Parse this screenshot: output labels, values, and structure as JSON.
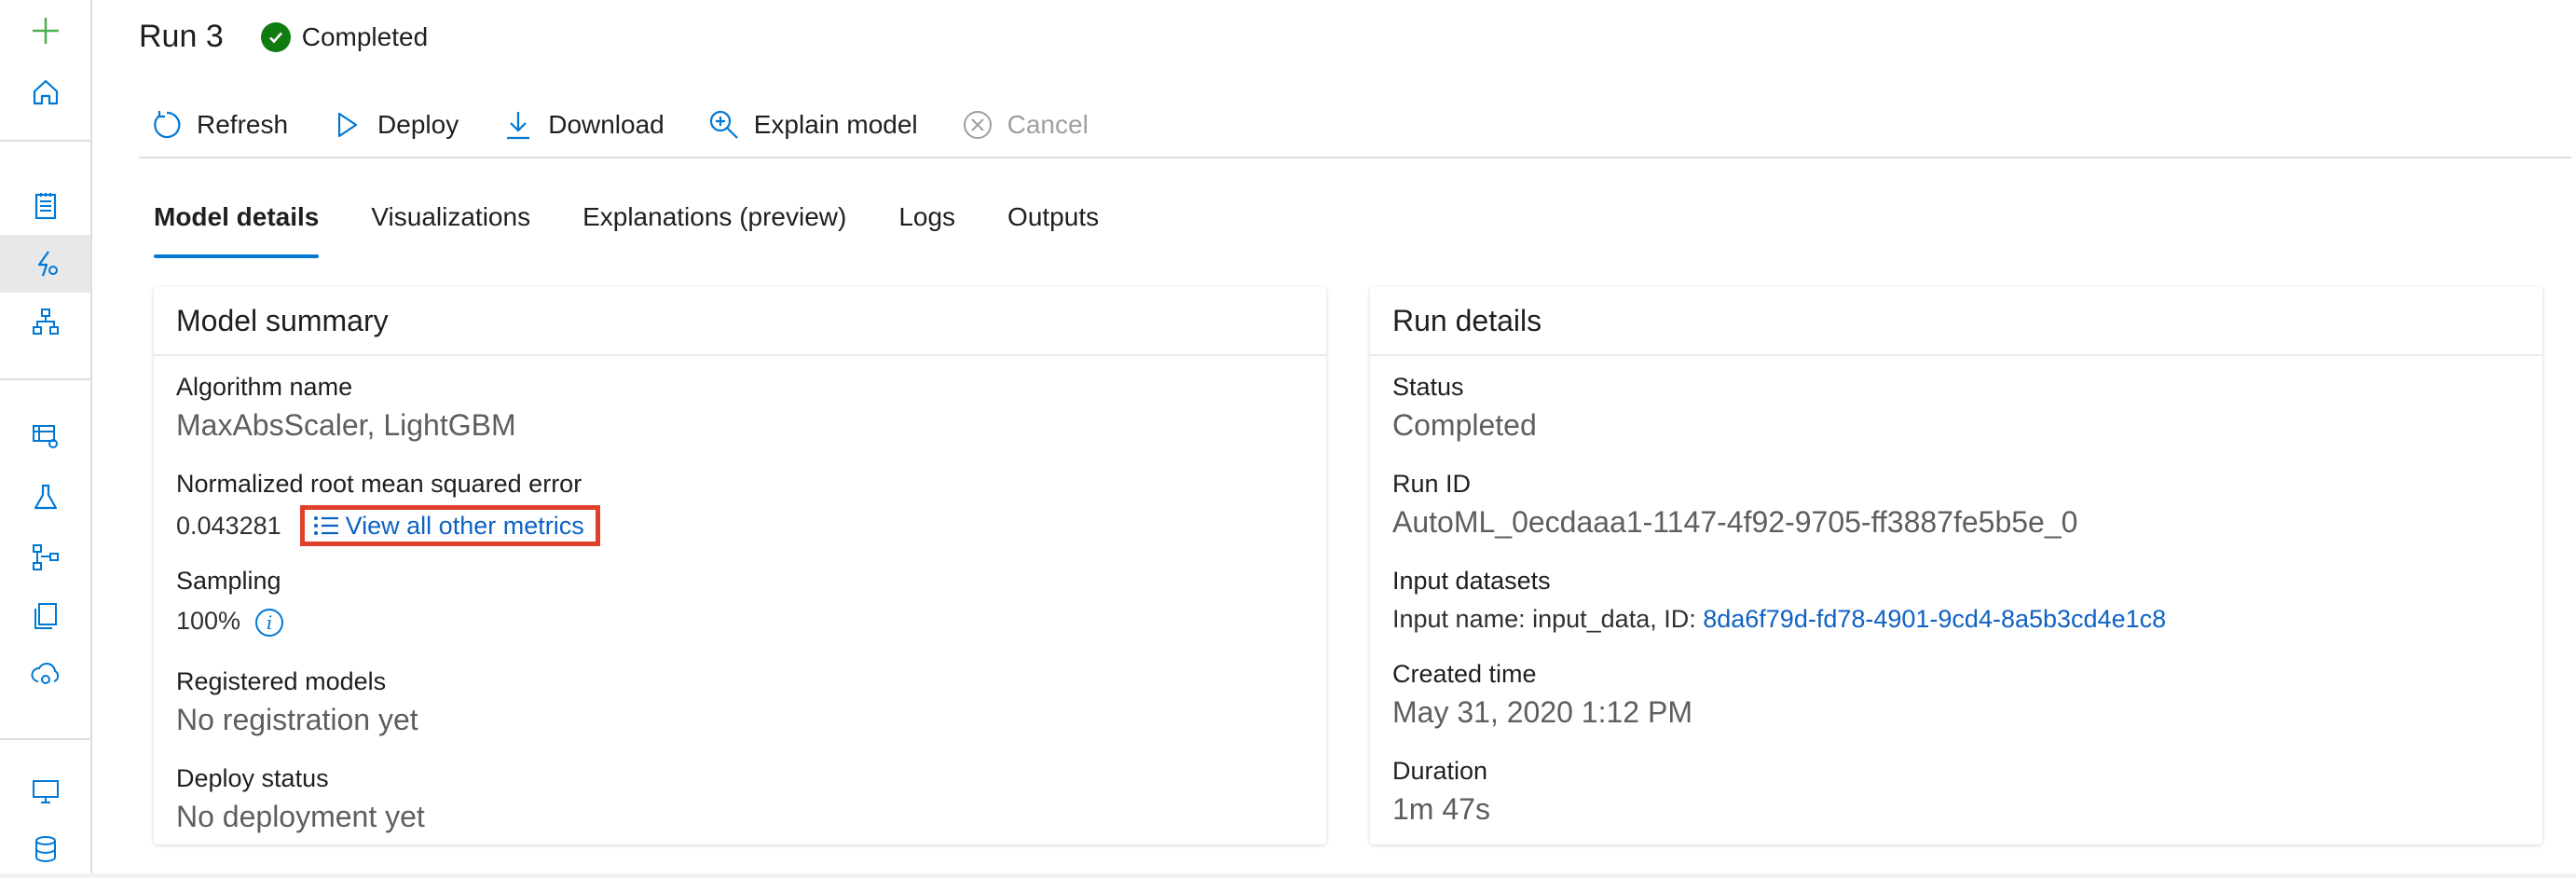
{
  "rail": {
    "items": [
      "add-icon",
      "home-icon",
      "notebook-icon",
      "automl-icon",
      "designer-icon",
      "datasets-icon",
      "experiments-icon",
      "pipelines-icon",
      "models-icon",
      "endpoints-icon",
      "compute-icon",
      "datastores-icon"
    ],
    "active": "automl-icon"
  },
  "header": {
    "title": "Run 3",
    "status": "Completed"
  },
  "toolbar": {
    "refresh": "Refresh",
    "deploy": "Deploy",
    "download": "Download",
    "explain": "Explain model",
    "cancel": "Cancel"
  },
  "tabs": [
    {
      "label": "Model details",
      "active": true
    },
    {
      "label": "Visualizations"
    },
    {
      "label": "Explanations (preview)"
    },
    {
      "label": "Logs"
    },
    {
      "label": "Outputs"
    }
  ],
  "model_summary": {
    "title": "Model summary",
    "algorithm_label": "Algorithm name",
    "algorithm_value": "MaxAbsScaler, LightGBM",
    "metric_label": "Normalized root mean squared error",
    "metric_value": "0.043281",
    "metrics_link": "View all other metrics",
    "sampling_label": "Sampling",
    "sampling_value": "100%",
    "registered_label": "Registered models",
    "registered_value": "No registration yet",
    "deploy_label": "Deploy status",
    "deploy_value": "No deployment yet"
  },
  "run_details": {
    "title": "Run details",
    "status_label": "Status",
    "status_value": "Completed",
    "runid_label": "Run ID",
    "runid_value": "AutoML_0ecdaaa1-1147-4f92-9705-ff3887fe5b5e_0",
    "datasets_label": "Input datasets",
    "datasets_prefix": "Input name: input_data, ID: ",
    "datasets_id": "8da6f79d-fd78-4901-9cd4-8a5b3cd4e1c8",
    "created_label": "Created time",
    "created_value": "May 31, 2020 1:12 PM",
    "duration_label": "Duration",
    "duration_value": "1m 47s"
  },
  "colors": {
    "accent": "#0078d4",
    "success": "#107c10",
    "highlight": "#e0402a",
    "link": "#0f62c4"
  }
}
